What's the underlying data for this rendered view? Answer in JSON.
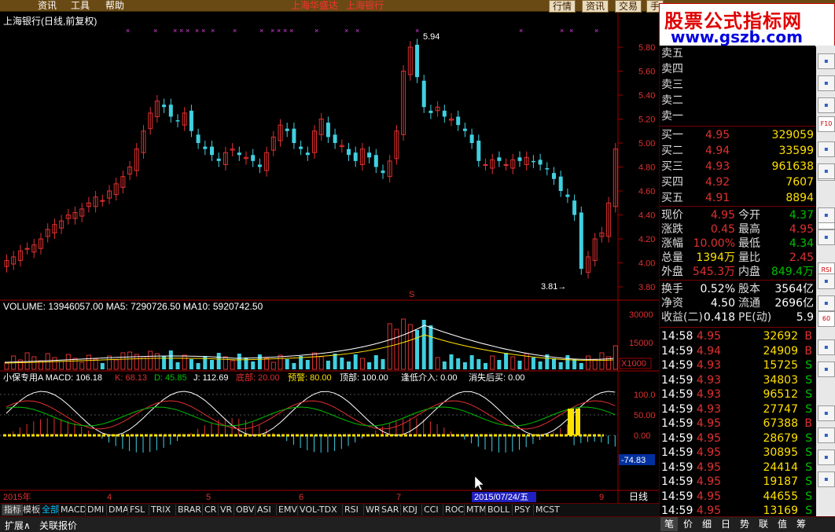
{
  "menubar": {
    "items": [
      "资讯",
      "工具",
      "帮助"
    ],
    "center_items": [
      "上海华盛达",
      "上海银行"
    ],
    "right_buttons": [
      "行情",
      "资讯",
      "交易",
      "手"
    ]
  },
  "watermark": {
    "line1": "股票公式指标网",
    "line2": "www.gszb.com"
  },
  "chart_title": "上海银行(日线,前复权)",
  "price_axis": [
    "5.80",
    "5.60",
    "5.40",
    "5.20",
    "5.00",
    "4.80",
    "4.60",
    "4.40",
    "4.20",
    "4.00",
    "3.80"
  ],
  "price_marks": {
    "high": "5.94",
    "low": "3.81"
  },
  "volume_header": "VOLUME: 13946057.00  MA5: 7290726.50  MA10: 5920742.50",
  "volume_axis": [
    "30000",
    "15000"
  ],
  "volume_unit": "X1000",
  "indicator_header": {
    "name": "小保专用A",
    "macd": "MACD: 106.18",
    "k": "K: 68.13",
    "d": "D: 45.85",
    "j": "J: 112.69",
    "bottom": "底部: 20.00",
    "warn": "预警: 80.00",
    "top": "顶部: 100.00",
    "buy_low": "逢低介入: 0.00",
    "sell": "消失后买: 0.00"
  },
  "indicator_axis": [
    "100.0",
    "50.00",
    "0.00"
  ],
  "indicator_value": "-74.83",
  "date_axis": {
    "year": "2015年",
    "months": [
      "4",
      "5",
      "6",
      "7",
      "9"
    ],
    "cursor_date": "2015/07/24/五"
  },
  "period": "日线",
  "sell_levels": [
    "卖五",
    "卖四",
    "卖三",
    "卖二",
    "卖一"
  ],
  "buy_levels": [
    {
      "label": "买一",
      "price": "4.95",
      "vol": "329059"
    },
    {
      "label": "买二",
      "price": "4.94",
      "vol": "33599"
    },
    {
      "label": "买三",
      "price": "4.93",
      "vol": "961638"
    },
    {
      "label": "买四",
      "price": "4.92",
      "vol": "7607"
    },
    {
      "label": "买五",
      "price": "4.91",
      "vol": "8894"
    }
  ],
  "quote": [
    {
      "l1": "现价",
      "v1": "4.95",
      "l2": "今开",
      "v2": "4.37"
    },
    {
      "l1": "涨跌",
      "v1": "0.45",
      "l2": "最高",
      "v2": "4.95"
    },
    {
      "l1": "涨幅",
      "v1": "10.00%",
      "l2": "最低",
      "v2": "4.34"
    },
    {
      "l1": "总量",
      "v1": "1394万",
      "l2": "量比",
      "v2": "2.45"
    },
    {
      "l1": "外盘",
      "v1": "545.3万",
      "l2": "内盘",
      "v2": "849.4万"
    }
  ],
  "fundamentals": [
    {
      "l1": "换手",
      "v1": "0.52%",
      "l2": "股本",
      "v2": "3564亿"
    },
    {
      "l1": "净资",
      "v1": "4.50",
      "l2": "流通",
      "v2": "2696亿"
    },
    {
      "l1": "收益(二)",
      "v1": "0.418",
      "l2": "PE(动)",
      "v2": "5.9"
    }
  ],
  "ticks": [
    {
      "t": "14:58",
      "p": "4.95",
      "v": "32692",
      "s": "B"
    },
    {
      "t": "14:59",
      "p": "4.94",
      "v": "24909",
      "s": "B"
    },
    {
      "t": "14:59",
      "p": "4.93",
      "v": "15725",
      "s": "S"
    },
    {
      "t": "14:59",
      "p": "4.93",
      "v": "34803",
      "s": "S"
    },
    {
      "t": "14:59",
      "p": "4.93",
      "v": "96512",
      "s": "S"
    },
    {
      "t": "14:59",
      "p": "4.93",
      "v": "27747",
      "s": "S"
    },
    {
      "t": "14:59",
      "p": "4.95",
      "v": "67388",
      "s": "B"
    },
    {
      "t": "14:59",
      "p": "4.95",
      "v": "28679",
      "s": "S"
    },
    {
      "t": "14:59",
      "p": "4.95",
      "v": "30895",
      "s": "S"
    },
    {
      "t": "14:59",
      "p": "4.95",
      "v": "24414",
      "s": "S"
    },
    {
      "t": "14:59",
      "p": "4.95",
      "v": "19187",
      "s": "S"
    },
    {
      "t": "14:59",
      "p": "4.95",
      "v": "44655",
      "s": "S"
    },
    {
      "t": "14:59",
      "p": "4.95",
      "v": "13169",
      "s": "S"
    }
  ],
  "indicator_tabs": [
    "指标",
    "模板",
    "全部",
    "MACD",
    "DMI",
    "DMA",
    "FSL",
    "TRIX",
    "BRAR",
    "CR",
    "VR",
    "OBV",
    "ASI",
    "EMV",
    "VOL-TDX",
    "RSI",
    "WR",
    "SAR",
    "KDJ",
    "CCI",
    "ROC",
    "MTM",
    "BOLL",
    "PSY",
    "MCST"
  ],
  "status": {
    "left1": "扩展∧",
    "left2": "关联报价"
  },
  "bottom_tabs": [
    "笔",
    "价",
    "细",
    "日",
    "势",
    "联",
    "值",
    "筹"
  ],
  "tools": [
    "F10",
    "F2",
    "SKD",
    "RSI",
    "60"
  ],
  "colors": {
    "up": "#e03030",
    "down": "#40d0e0",
    "ma_white": "#ffffff",
    "ma_yellow": "#ffe000",
    "ma_green": "#00c000",
    "ma_red": "#ff3030",
    "axis": "#a00000"
  }
}
